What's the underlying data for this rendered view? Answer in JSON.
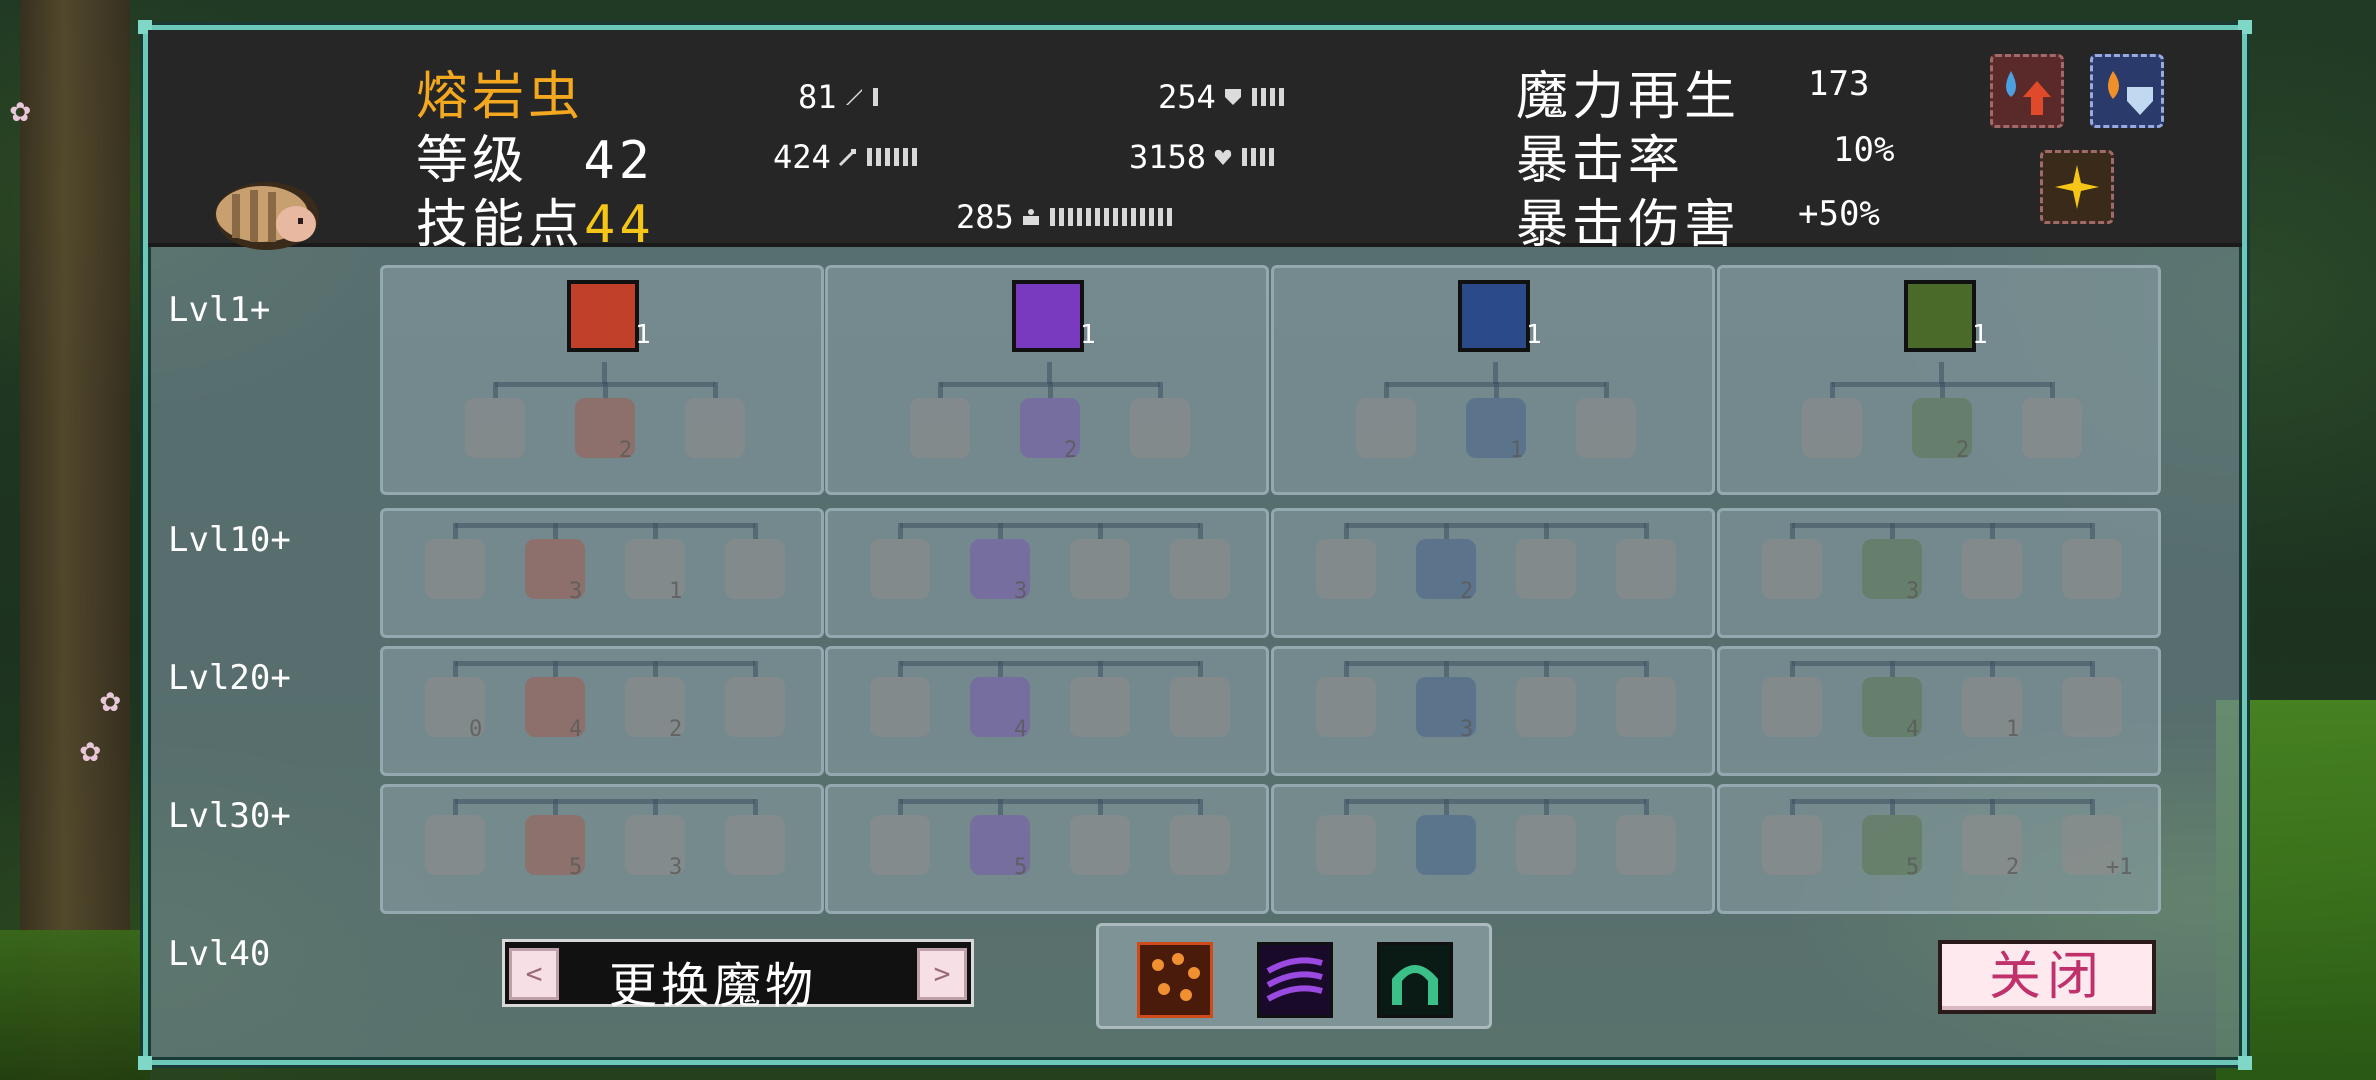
{
  "monster": {
    "name": "熔岩虫",
    "level_label": "等级",
    "level_value": "42",
    "skill_points_label": "技能点",
    "skill_points_value": "44"
  },
  "stats": {
    "attack": "81",
    "magic_attack": "424",
    "defense": "254",
    "hp": "3158",
    "weight": "285"
  },
  "right_stats": {
    "mana_regen_label": "魔力再生",
    "mana_regen_value": "173",
    "crit_rate_label": "暴击率",
    "crit_rate_value": "10%",
    "crit_damage_label": "暴击伤害",
    "crit_damage_value": "+50%"
  },
  "level_labels": [
    "Lvl1+",
    "Lvl10+",
    "Lvl20+",
    "Lvl30+",
    "Lvl40"
  ],
  "trees": [
    {
      "root_icon": "lava-orbs-icon",
      "root_count": "1",
      "color": "#c0402a",
      "nodes": {
        "r1": [
          "",
          "2",
          ""
        ],
        "r2": [
          "",
          "3",
          "1",
          ""
        ],
        "r3": [
          "0",
          "4",
          "2",
          ""
        ],
        "r4": [
          "",
          "5",
          "3",
          ""
        ]
      }
    },
    {
      "root_icon": "claw-slash-icon",
      "root_count": "1",
      "color": "#7a3ac0",
      "nodes": {
        "r1": [
          "",
          "2",
          ""
        ],
        "r2": [
          "",
          "3",
          "",
          ""
        ],
        "r3": [
          "",
          "4",
          "",
          ""
        ],
        "r4": [
          "",
          "5",
          "",
          ""
        ]
      }
    },
    {
      "root_icon": "shield-icon",
      "root_count": "1",
      "color": "#2a4a8a",
      "nodes": {
        "r1": [
          "",
          "1",
          ""
        ],
        "r2": [
          "",
          "2",
          "",
          ""
        ],
        "r3": [
          "",
          "3",
          "",
          ""
        ],
        "r4": [
          "",
          "",
          "",
          ""
        ]
      }
    },
    {
      "root_icon": "bubble-shield-icon",
      "root_count": "1",
      "color": "#4a6a2a",
      "nodes": {
        "r1": [
          "",
          "2",
          ""
        ],
        "r2": [
          "",
          "3",
          "",
          ""
        ],
        "r3": [
          "",
          "4",
          "1",
          ""
        ],
        "r4": [
          "",
          "5",
          "2",
          "+1"
        ]
      }
    }
  ],
  "buttons": {
    "change_monster": "更换魔物",
    "prev": "<",
    "next": ">",
    "close": "关闭"
  },
  "active_skills": [
    "lava-rain-icon",
    "triple-slash-icon",
    "arch-gate-icon"
  ],
  "buff_icons": [
    "mana-up-icon",
    "fire-shield-icon",
    "sparkle-icon"
  ],
  "colors": {
    "name": "#f3a81f",
    "skill_points": "#f5c518",
    "frame": "#6cc8b8",
    "close_text": "#c0306a"
  }
}
